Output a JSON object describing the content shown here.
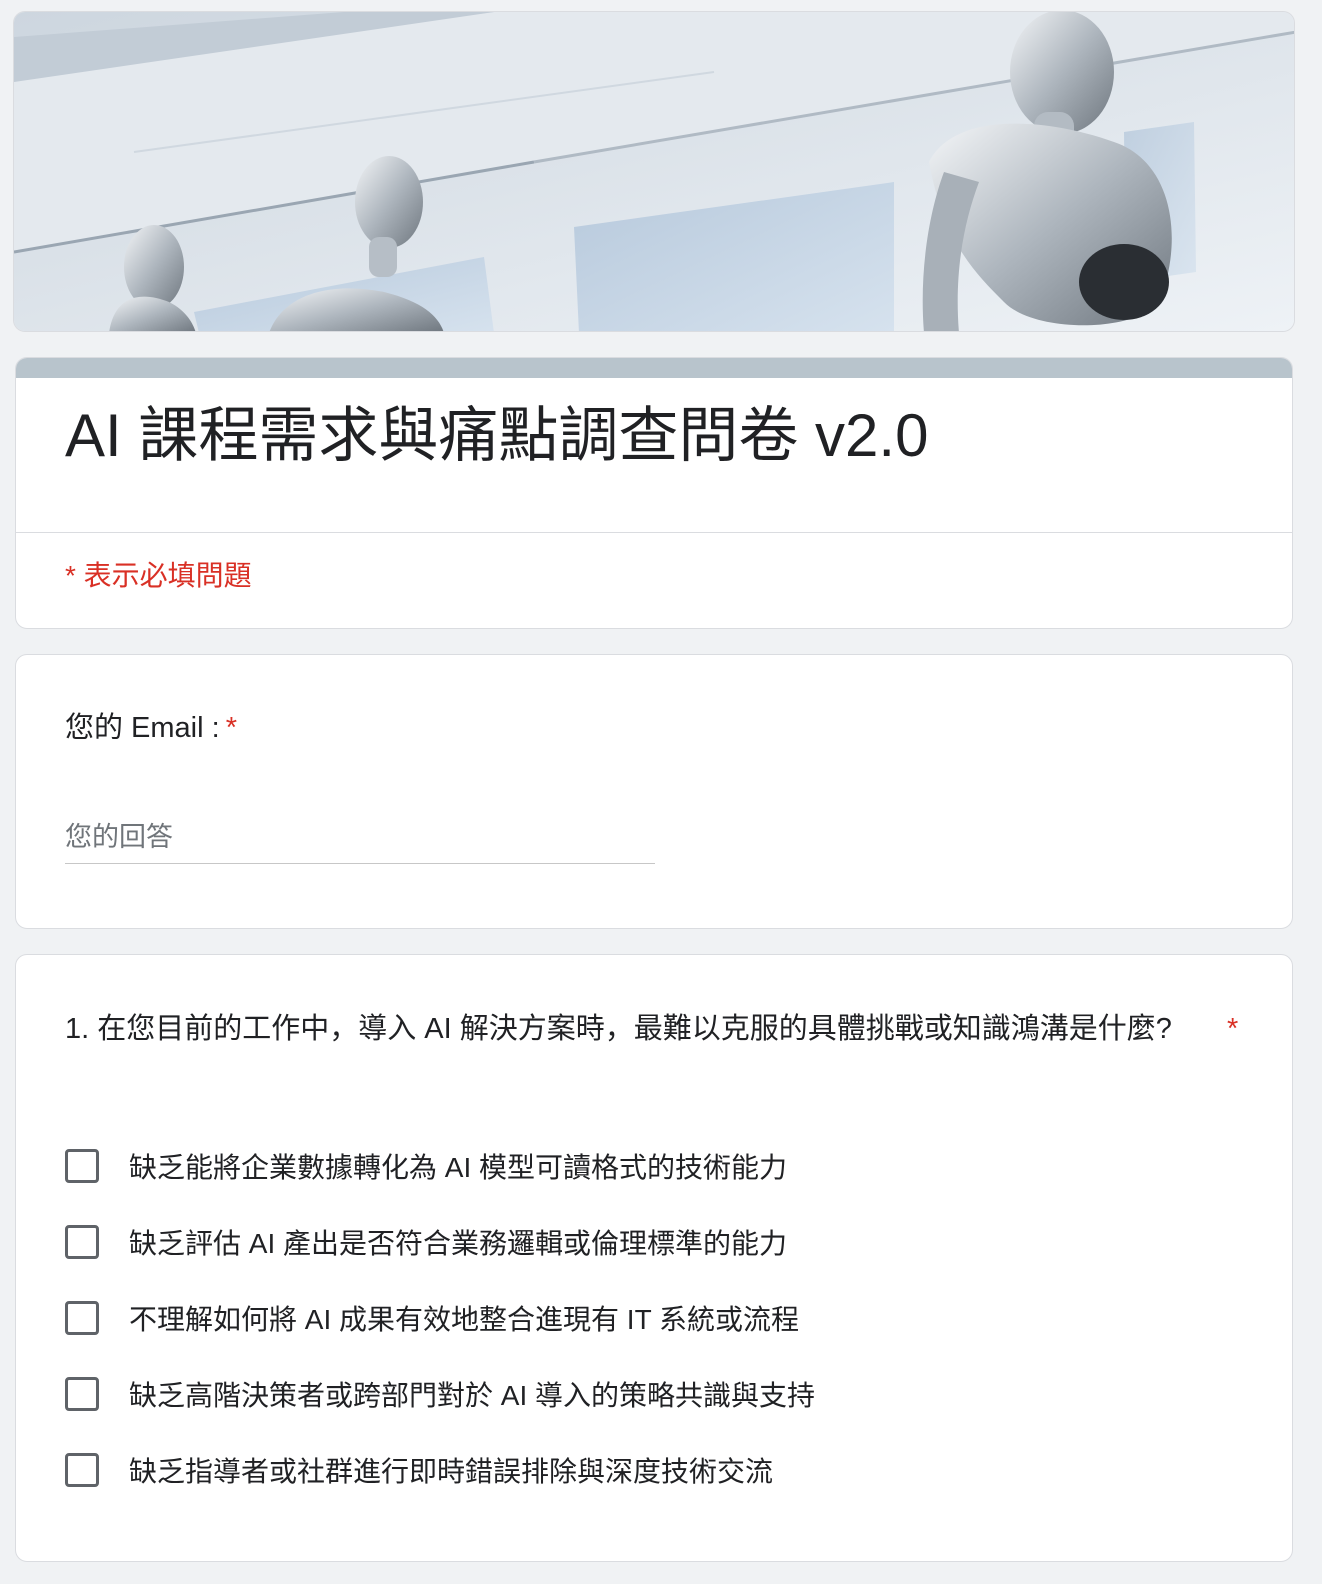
{
  "form": {
    "title": "AI 課程需求與痛點調查問卷 v2.0",
    "required_note": "* 表示必填問題"
  },
  "email_question": {
    "label": "您的 Email :",
    "required_mark": "*",
    "placeholder": "您的回答"
  },
  "question1": {
    "text": "1. 在您目前的工作中，導入 AI 解決方案時，最難以克服的具體挑戰或知識鴻溝是什麼?",
    "required_mark": "*",
    "options": [
      "缺乏能將企業數據轉化為 AI 模型可讀格式的技術能力",
      "缺乏評估 AI 產出是否符合業務邏輯或倫理標準的能力",
      "不理解如何將 AI 成果有效地整合進現有 IT 系統或流程",
      "缺乏高階決策者或跨部門對於 AI 導入的策略共識與支持",
      "缺乏指導者或社群進行即時錯誤排除與深度技術交流"
    ]
  },
  "colors": {
    "background": "#f0f2f4",
    "accent_bar": "#b8c4cc",
    "required_red": "#d93025"
  }
}
